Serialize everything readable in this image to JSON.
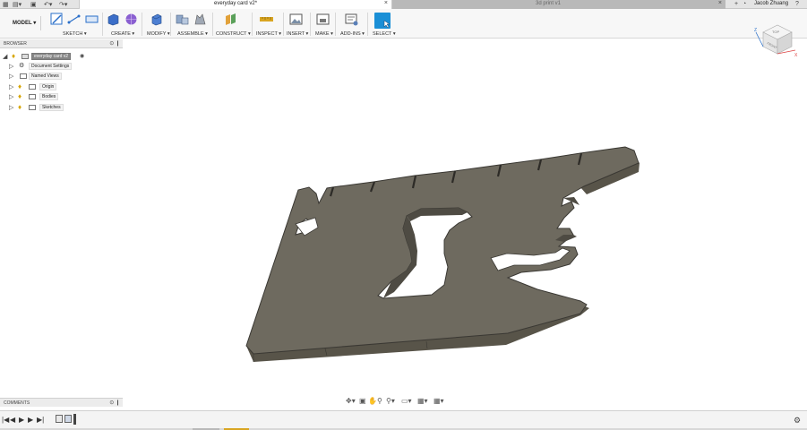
{
  "tabs": {
    "active": "everyday card v2*",
    "inactive": "3d print v1",
    "close_glyph": "×",
    "user": "Jacob Zhuang"
  },
  "quick_access": {
    "icons": [
      "data-panel-icon",
      "file-icon",
      "save-icon",
      "undo-icon",
      "redo-icon",
      "new-tab-icon",
      "job-status-icon",
      "notifications-icon",
      "help-icon"
    ]
  },
  "toolbar": {
    "workspace": "MODEL ▾",
    "groups": [
      {
        "label": "SKETCH ▾",
        "icons": [
          "create-sketch-icon",
          "line-icon",
          "rectangle-icon"
        ]
      },
      {
        "label": "CREATE ▾",
        "icons": [
          "extrude-icon",
          "sphere-icon"
        ]
      },
      {
        "label": "MODIFY ▾",
        "icons": [
          "press-pull-icon"
        ]
      },
      {
        "label": "ASSEMBLE ▾",
        "icons": [
          "new-component-icon",
          "joint-icon"
        ]
      },
      {
        "label": "CONSTRUCT ▾",
        "icons": [
          "offset-plane-icon"
        ]
      },
      {
        "label": "INSPECT ▾",
        "icons": [
          "measure-icon"
        ]
      },
      {
        "label": "INSERT ▾",
        "icons": [
          "insert-image-icon"
        ]
      },
      {
        "label": "MAKE ▾",
        "icons": [
          "print-3d-icon"
        ]
      },
      {
        "label": "ADD-INS ▾",
        "icons": [
          "scripts-icon"
        ]
      },
      {
        "label": "SELECT ▾",
        "icons": [
          "select-icon"
        ]
      }
    ],
    "colors": {
      "sketch": "#2a6fc9",
      "create": "#3b6ec8",
      "create_sphere": "#8a5fd1",
      "construct": "#e2a13a",
      "inspect": "#d9a521",
      "select": "#1a8fd6"
    }
  },
  "browser": {
    "title": "BROWSER",
    "root": "everyday card v2",
    "items": [
      {
        "label": "Document Settings",
        "icon": "gear-icon"
      },
      {
        "label": "Named Views",
        "icon": "folder-icon"
      },
      {
        "label": "Origin",
        "icon": "folder-icon"
      },
      {
        "label": "Bodies",
        "icon": "folder-icon"
      },
      {
        "label": "Sketches",
        "icon": "folder-icon"
      }
    ]
  },
  "comments": {
    "title": "COMMENTS"
  },
  "viewcube": {
    "top": "TOP",
    "front": "FRONT",
    "axis_x": "X",
    "axis_z": "Z"
  },
  "model": {
    "body_color": "#6e6a5f",
    "edge_color": "#3a3833",
    "side_color": "#585449"
  },
  "navbar": {
    "icons": [
      "orbit-icon",
      "pan-hand-icon",
      "look-at-icon",
      "zoom-icon",
      "fit-icon",
      "display-settings-icon",
      "grid-icon",
      "viewports-icon"
    ]
  },
  "timeline": {
    "controls": [
      "first-icon",
      "previous-icon",
      "play-icon",
      "next-icon",
      "last-icon"
    ]
  }
}
